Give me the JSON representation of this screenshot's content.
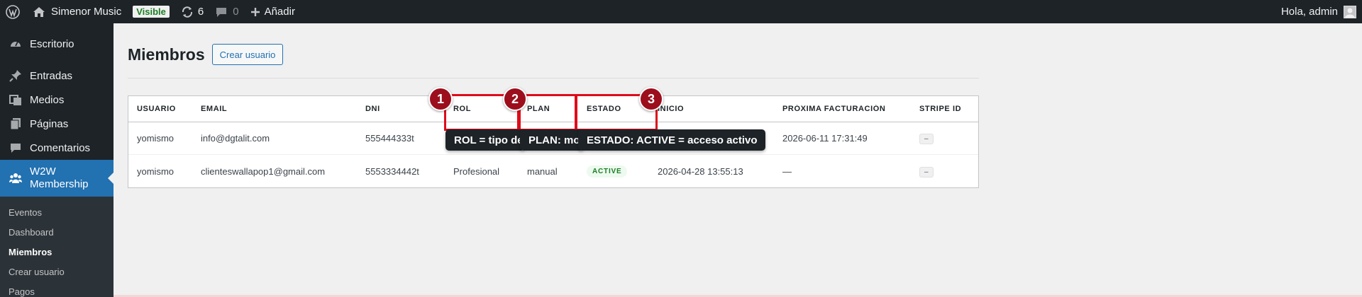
{
  "adminbar": {
    "site_name": "Simenor Music",
    "visible_badge": "Visible",
    "updates_count": "6",
    "comments_count": "0",
    "new_label": "Añadir",
    "greeting": "Hola, admin",
    "icons": [
      "wordpress-logo-icon",
      "home-icon",
      "updates-icon",
      "comment-icon",
      "plus-icon",
      "avatar"
    ]
  },
  "sidebar": {
    "items": [
      {
        "label": "Escritorio",
        "icon": "dashboard-icon"
      },
      {
        "label": "Entradas",
        "icon": "pin-icon"
      },
      {
        "label": "Medios",
        "icon": "media-icon"
      },
      {
        "label": "Páginas",
        "icon": "page-icon"
      },
      {
        "label": "Comentarios",
        "icon": "comment-icon"
      }
    ],
    "active": {
      "label_line1": "W2W",
      "label_line2": "Membership",
      "icon": "groups-icon"
    },
    "submenu": [
      "Eventos",
      "Dashboard",
      "Miembros",
      "Crear usuario",
      "Pagos"
    ],
    "current_sub": "Miembros"
  },
  "main": {
    "title": "Miembros",
    "create_button": "Crear usuario",
    "table": {
      "headers": [
        "USUARIO",
        "EMAIL",
        "DNI",
        "ROL",
        "PLAN",
        "ESTADO",
        "INICIO",
        "PRÓXIMA FACTURACIÓN",
        "STRIPE ID"
      ],
      "rows": [
        {
          "usuario": "yomismo",
          "email": "info@dgtalit.com",
          "dni": "555444333t",
          "rol": "",
          "plan": "",
          "estado": "",
          "inicio": "",
          "proxima": "2026-06-11 17:31:49",
          "stripe": "–"
        },
        {
          "usuario": "yomismo",
          "email": "clienteswallapop1@gmail.com",
          "dni": "5553334442t",
          "rol": "Profesional",
          "plan": "manual",
          "estado": "ACTIVE",
          "inicio": "2026-04-28 13:55:13",
          "proxima": "—",
          "stripe": "–"
        }
      ]
    }
  },
  "annotations": {
    "markers": [
      "1",
      "2",
      "3"
    ],
    "tooltips": [
      "ROL = tipo de",
      "PLAN: mo",
      "ESTADO: ACTIVE = acceso activo"
    ],
    "highlight_color": "#e00b1a",
    "marker_color": "#9c0e1c"
  },
  "colors": {
    "accent": "#2271b1",
    "adminbar_bg": "#1d2327",
    "active_green": "#1a7e24"
  }
}
